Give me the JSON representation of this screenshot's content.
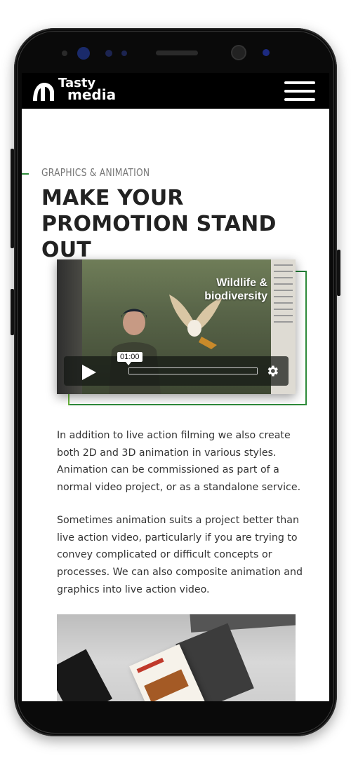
{
  "header": {
    "logo_line1": "Tasty",
    "logo_line2": "media",
    "menu_icon": "hamburger-menu-icon"
  },
  "section": {
    "eyebrow": "GRAPHICS & ANIMATION",
    "heading": "MAKE YOUR PROMOTION STAND OUT"
  },
  "video": {
    "title": "Wildlife & biodiversity",
    "time": "01:00",
    "play_icon": "play-icon",
    "settings_icon": "gear-icon"
  },
  "content": {
    "paragraph1": "In addition to live action filming we also create both 2D and 3D animation in various styles. Animation can be commissioned as part of a normal video project, or as a standalone service.",
    "paragraph2": "Sometimes animation suits a project better than live action video, particularly if you are trying to convey complicated or difficult concepts or processes. We can also composite animation and graphics into live action video."
  },
  "colors": {
    "accent_green": "#2e8b3a",
    "header_bg": "#000000",
    "heading_text": "#222222"
  }
}
